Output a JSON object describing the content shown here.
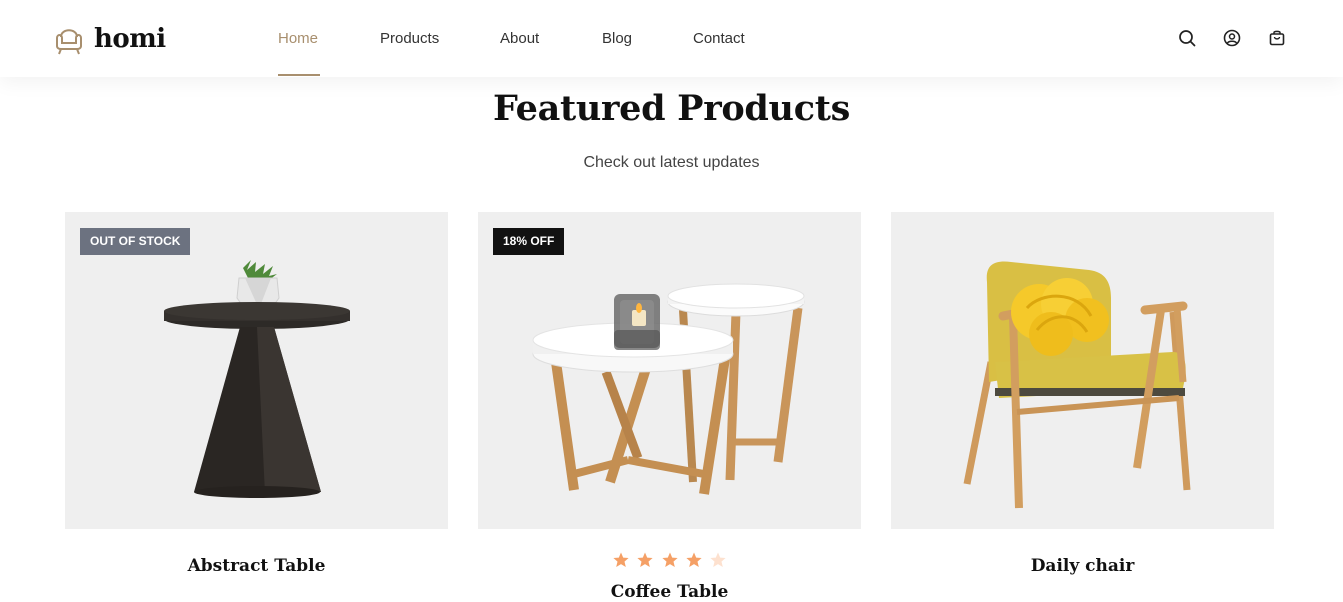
{
  "header": {
    "logo_text": "homi",
    "nav": [
      {
        "label": "Home",
        "active": true
      },
      {
        "label": "Products",
        "active": false
      },
      {
        "label": "About",
        "active": false
      },
      {
        "label": "Blog",
        "active": false
      },
      {
        "label": "Contact",
        "active": false
      }
    ],
    "icons": [
      "search-icon",
      "user-icon",
      "shopping-bag-icon"
    ],
    "accent_color": "#a88f6e"
  },
  "section": {
    "title": "Featured Products",
    "subtitle": "Check out latest updates"
  },
  "products": [
    {
      "name": "Abstract Table",
      "badge": "OUT OF STOCK",
      "badge_color": "#6c7280",
      "rating": null
    },
    {
      "name": "Coffee Table",
      "badge": "18% OFF",
      "badge_color": "#121212",
      "rating": 4,
      "rating_max": 5,
      "star_color": "#f5a066"
    },
    {
      "name": "Daily chair",
      "badge": "",
      "rating": null
    }
  ]
}
